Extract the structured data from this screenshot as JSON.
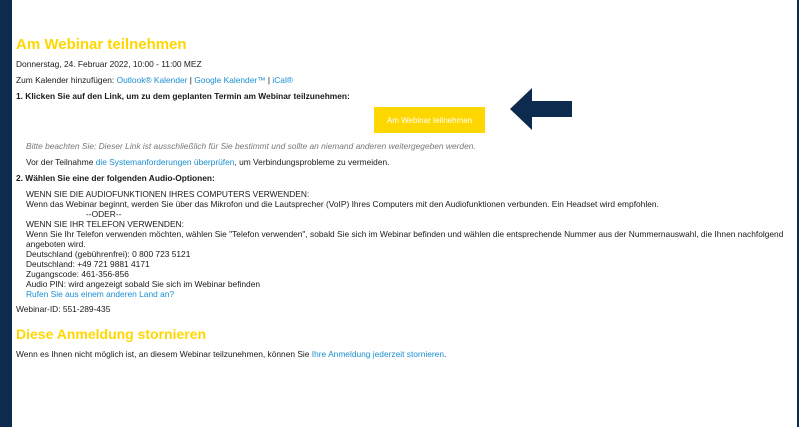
{
  "colors": {
    "accent": "#ffd700",
    "link": "#1a8fd1",
    "frame": "#0d2a4f"
  },
  "title": "Am Webinar teilnehmen",
  "date": "Donnerstag, 24. Februar 2022, 10:00 - 11:00 MEZ",
  "calendar": {
    "prefix": "Zum Kalender hinzufügen: ",
    "outlook": "Outlook® Kalender",
    "sep1": " | ",
    "google": "Google Kalender™",
    "sep2": " | ",
    "ical": "iCal®"
  },
  "step1": "1. Klicken Sie auf den Link, um zu dem geplanten Termin am Webinar teilzunehmen:",
  "join_button": "Am Webinar teilnehmen",
  "arrow_icon": "left-arrow-icon",
  "note": "Bitte beachten Sie: Dieser Link ist ausschließlich für Sie bestimmt und sollte an niemand anderen weitergegeben werden.",
  "requirements": {
    "prefix": "Vor der Teilnahme ",
    "link": "die Systemanforderungen überprüfen",
    "suffix": ", um Verbindungsprobleme zu vermeiden."
  },
  "step2": "2. Wählen Sie eine der folgenden Audio-Optionen:",
  "audio": {
    "computer_heading": "WENN SIE DIE AUDIOFUNKTIONEN IHRES COMPUTERS VERWENDEN:",
    "computer_text": "Wenn das Webinar beginnt, werden Sie über das Mikrofon und die Lautsprecher (VoIP) Ihres Computers mit den Audiofunktionen verbunden. Ein Headset wird empfohlen.",
    "or": "--ODER--",
    "phone_heading": "WENN SIE IHR TELEFON VERWENDEN:",
    "phone_text": "Wenn Sie Ihr Telefon verwenden möchten, wählen Sie \"Telefon verwenden\", sobald Sie sich im Webinar befinden und wählen die entsprechende Nummer aus der Nummernauswahl, die Ihnen nachfolgend angeboten wird.",
    "de_free": "Deutschland (gebührenfrei): 0 800 723 5121",
    "de": "Deutschland: +49 721 9881 4171",
    "access_code": "Zugangscode: 461-356-856",
    "audio_pin": "Audio PIN: wird angezeigt sobald Sie sich im Webinar befinden",
    "other_country": "Rufen Sie aus einem anderen Land an?"
  },
  "webinar_id": "Webinar-ID: 551-289-435",
  "cancel": {
    "title": "Diese Anmeldung stornieren",
    "prefix": "Wenn es Ihnen nicht möglich ist, an diesem Webinar teilzunehmen, können Sie ",
    "link": "Ihre Anmeldung jederzeit stornieren",
    "suffix": "."
  }
}
